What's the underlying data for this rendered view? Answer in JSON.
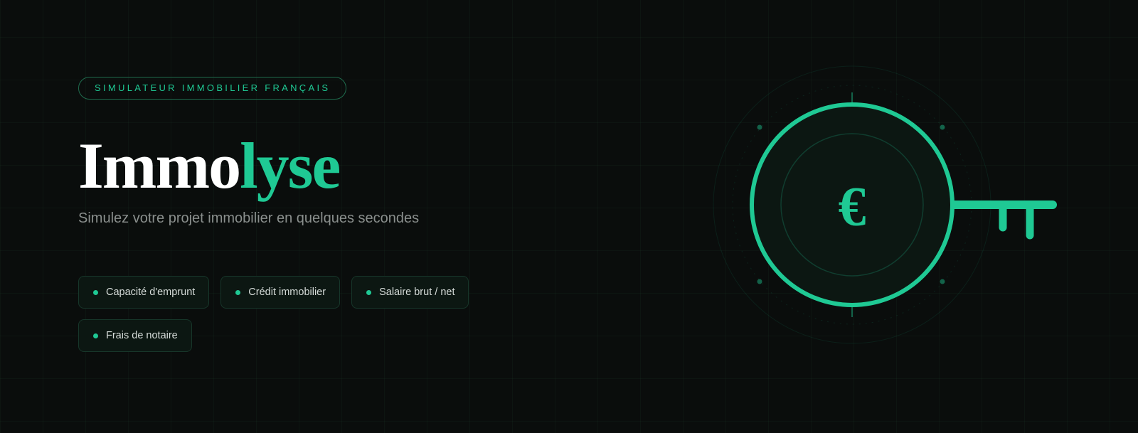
{
  "hero": {
    "tagline": "SIMULATEUR IMMOBILIER FRANÇAIS",
    "title_part1": "Immo",
    "title_part2": "lyse",
    "subtitle": "Simulez votre projet immobilier en quelques secondes",
    "features": [
      {
        "label": "Capacité d'emprunt"
      },
      {
        "label": "Crédit immobilier"
      },
      {
        "label": "Salaire brut / net"
      },
      {
        "label": "Frais de notaire"
      }
    ]
  },
  "illustration": {
    "symbol": "€",
    "icon": "euro-key-icon"
  },
  "colors": {
    "background": "#0a0d0c",
    "accent": "#1fc994",
    "title_white": "#ffffff",
    "subtitle_gray": "#8a8f8d",
    "chip_text": "#d6dcd9"
  }
}
